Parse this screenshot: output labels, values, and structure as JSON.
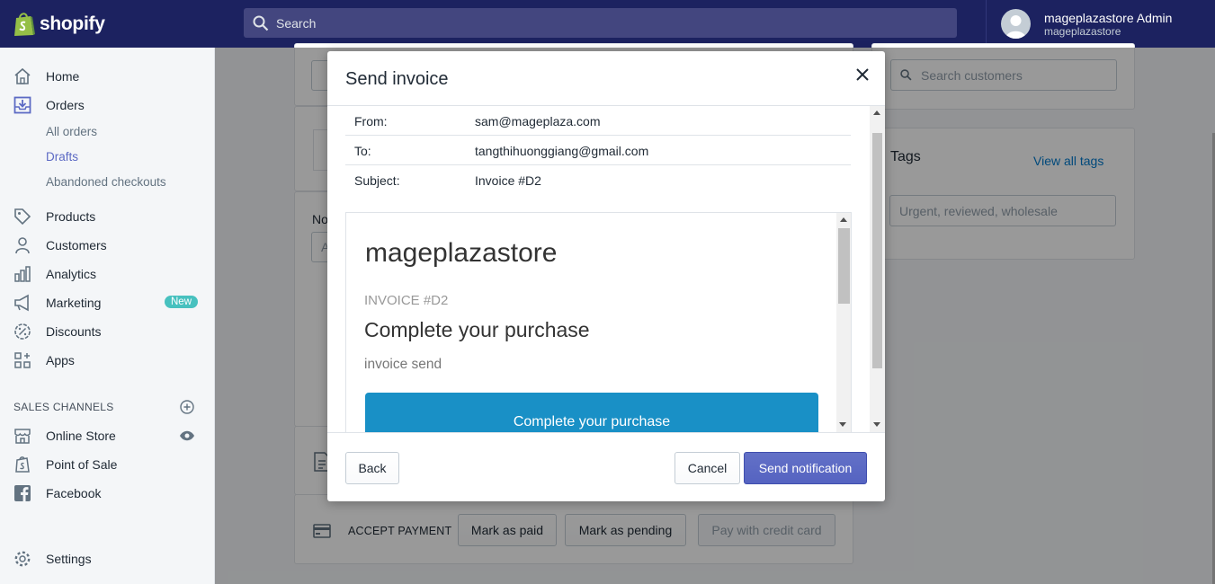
{
  "topbar": {
    "logo_text": "shopify",
    "search_placeholder": "Search",
    "account_name": "mageplazastore Admin",
    "account_store": "mageplazastore"
  },
  "sidebar": {
    "items": [
      {
        "label": "Home",
        "icon": "home-icon"
      },
      {
        "label": "Orders",
        "icon": "orders-icon"
      },
      {
        "label": "Products",
        "icon": "tag-icon"
      },
      {
        "label": "Customers",
        "icon": "person-icon"
      },
      {
        "label": "Analytics",
        "icon": "bar-chart-icon"
      },
      {
        "label": "Marketing",
        "icon": "megaphone-icon"
      },
      {
        "label": "Discounts",
        "icon": "discount-icon"
      },
      {
        "label": "Apps",
        "icon": "apps-icon"
      }
    ],
    "orders_sub": [
      "All orders",
      "Drafts",
      "Abandoned checkouts"
    ],
    "marketing_badge": "New",
    "sales_channels_title": "SALES CHANNELS",
    "channels": [
      {
        "label": "Online Store",
        "icon": "store-icon"
      },
      {
        "label": "Point of Sale",
        "icon": "pos-icon"
      },
      {
        "label": "Facebook",
        "icon": "facebook-icon"
      }
    ],
    "settings": "Settings"
  },
  "background": {
    "search_customers_placeholder": "Search customers",
    "tags_title": "Tags",
    "view_all_tags": "View all tags",
    "tags_placeholder": "Urgent, reviewed, wholesale",
    "notes_label_partial": "No",
    "notes_input_partial": "A",
    "accept_payment": "ACCEPT PAYMENT",
    "mark_as_paid": "Mark as paid",
    "mark_as_pending": "Mark as pending",
    "pay_with_credit_card": "Pay with credit card"
  },
  "modal": {
    "title": "Send invoice",
    "rows": [
      {
        "key": "From:",
        "value": "sam@mageplaza.com"
      },
      {
        "key": "To:",
        "value": "tangthihuonggiang@gmail.com"
      },
      {
        "key": "Subject:",
        "value": "Invoice #D2"
      }
    ],
    "preview": {
      "store_name": "mageplazastore",
      "invoice_number": "INVOICE #D2",
      "heading": "Complete your purchase",
      "message": "invoice send",
      "button": "Complete your purchase"
    },
    "back": "Back",
    "cancel": "Cancel",
    "send": "Send notification"
  },
  "colors": {
    "topbar": "#1c2260",
    "primary": "#5c6ac4",
    "preview_button": "#1990c6",
    "badge": "#47c1bf"
  }
}
